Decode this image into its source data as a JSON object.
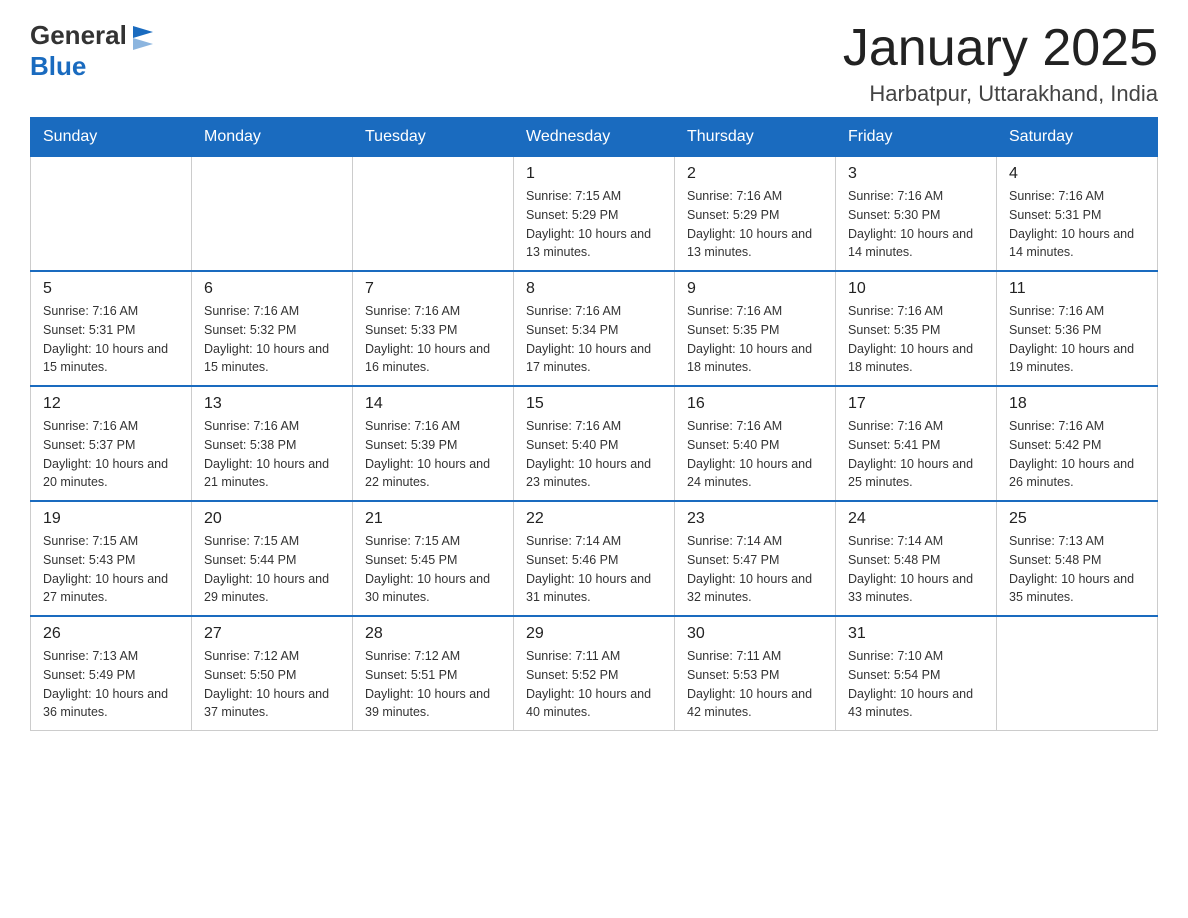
{
  "header": {
    "logo": {
      "general": "General",
      "blue": "Blue"
    },
    "title": "January 2025",
    "subtitle": "Harbatpur, Uttarakhand, India"
  },
  "days_of_week": [
    "Sunday",
    "Monday",
    "Tuesday",
    "Wednesday",
    "Thursday",
    "Friday",
    "Saturday"
  ],
  "weeks": [
    {
      "days": [
        {
          "number": "",
          "info": ""
        },
        {
          "number": "",
          "info": ""
        },
        {
          "number": "",
          "info": ""
        },
        {
          "number": "1",
          "info": "Sunrise: 7:15 AM\nSunset: 5:29 PM\nDaylight: 10 hours\nand 13 minutes."
        },
        {
          "number": "2",
          "info": "Sunrise: 7:16 AM\nSunset: 5:29 PM\nDaylight: 10 hours\nand 13 minutes."
        },
        {
          "number": "3",
          "info": "Sunrise: 7:16 AM\nSunset: 5:30 PM\nDaylight: 10 hours\nand 14 minutes."
        },
        {
          "number": "4",
          "info": "Sunrise: 7:16 AM\nSunset: 5:31 PM\nDaylight: 10 hours\nand 14 minutes."
        }
      ]
    },
    {
      "days": [
        {
          "number": "5",
          "info": "Sunrise: 7:16 AM\nSunset: 5:31 PM\nDaylight: 10 hours\nand 15 minutes."
        },
        {
          "number": "6",
          "info": "Sunrise: 7:16 AM\nSunset: 5:32 PM\nDaylight: 10 hours\nand 15 minutes."
        },
        {
          "number": "7",
          "info": "Sunrise: 7:16 AM\nSunset: 5:33 PM\nDaylight: 10 hours\nand 16 minutes."
        },
        {
          "number": "8",
          "info": "Sunrise: 7:16 AM\nSunset: 5:34 PM\nDaylight: 10 hours\nand 17 minutes."
        },
        {
          "number": "9",
          "info": "Sunrise: 7:16 AM\nSunset: 5:35 PM\nDaylight: 10 hours\nand 18 minutes."
        },
        {
          "number": "10",
          "info": "Sunrise: 7:16 AM\nSunset: 5:35 PM\nDaylight: 10 hours\nand 18 minutes."
        },
        {
          "number": "11",
          "info": "Sunrise: 7:16 AM\nSunset: 5:36 PM\nDaylight: 10 hours\nand 19 minutes."
        }
      ]
    },
    {
      "days": [
        {
          "number": "12",
          "info": "Sunrise: 7:16 AM\nSunset: 5:37 PM\nDaylight: 10 hours\nand 20 minutes."
        },
        {
          "number": "13",
          "info": "Sunrise: 7:16 AM\nSunset: 5:38 PM\nDaylight: 10 hours\nand 21 minutes."
        },
        {
          "number": "14",
          "info": "Sunrise: 7:16 AM\nSunset: 5:39 PM\nDaylight: 10 hours\nand 22 minutes."
        },
        {
          "number": "15",
          "info": "Sunrise: 7:16 AM\nSunset: 5:40 PM\nDaylight: 10 hours\nand 23 minutes."
        },
        {
          "number": "16",
          "info": "Sunrise: 7:16 AM\nSunset: 5:40 PM\nDaylight: 10 hours\nand 24 minutes."
        },
        {
          "number": "17",
          "info": "Sunrise: 7:16 AM\nSunset: 5:41 PM\nDaylight: 10 hours\nand 25 minutes."
        },
        {
          "number": "18",
          "info": "Sunrise: 7:16 AM\nSunset: 5:42 PM\nDaylight: 10 hours\nand 26 minutes."
        }
      ]
    },
    {
      "days": [
        {
          "number": "19",
          "info": "Sunrise: 7:15 AM\nSunset: 5:43 PM\nDaylight: 10 hours\nand 27 minutes."
        },
        {
          "number": "20",
          "info": "Sunrise: 7:15 AM\nSunset: 5:44 PM\nDaylight: 10 hours\nand 29 minutes."
        },
        {
          "number": "21",
          "info": "Sunrise: 7:15 AM\nSunset: 5:45 PM\nDaylight: 10 hours\nand 30 minutes."
        },
        {
          "number": "22",
          "info": "Sunrise: 7:14 AM\nSunset: 5:46 PM\nDaylight: 10 hours\nand 31 minutes."
        },
        {
          "number": "23",
          "info": "Sunrise: 7:14 AM\nSunset: 5:47 PM\nDaylight: 10 hours\nand 32 minutes."
        },
        {
          "number": "24",
          "info": "Sunrise: 7:14 AM\nSunset: 5:48 PM\nDaylight: 10 hours\nand 33 minutes."
        },
        {
          "number": "25",
          "info": "Sunrise: 7:13 AM\nSunset: 5:48 PM\nDaylight: 10 hours\nand 35 minutes."
        }
      ]
    },
    {
      "days": [
        {
          "number": "26",
          "info": "Sunrise: 7:13 AM\nSunset: 5:49 PM\nDaylight: 10 hours\nand 36 minutes."
        },
        {
          "number": "27",
          "info": "Sunrise: 7:12 AM\nSunset: 5:50 PM\nDaylight: 10 hours\nand 37 minutes."
        },
        {
          "number": "28",
          "info": "Sunrise: 7:12 AM\nSunset: 5:51 PM\nDaylight: 10 hours\nand 39 minutes."
        },
        {
          "number": "29",
          "info": "Sunrise: 7:11 AM\nSunset: 5:52 PM\nDaylight: 10 hours\nand 40 minutes."
        },
        {
          "number": "30",
          "info": "Sunrise: 7:11 AM\nSunset: 5:53 PM\nDaylight: 10 hours\nand 42 minutes."
        },
        {
          "number": "31",
          "info": "Sunrise: 7:10 AM\nSunset: 5:54 PM\nDaylight: 10 hours\nand 43 minutes."
        },
        {
          "number": "",
          "info": ""
        }
      ]
    }
  ]
}
